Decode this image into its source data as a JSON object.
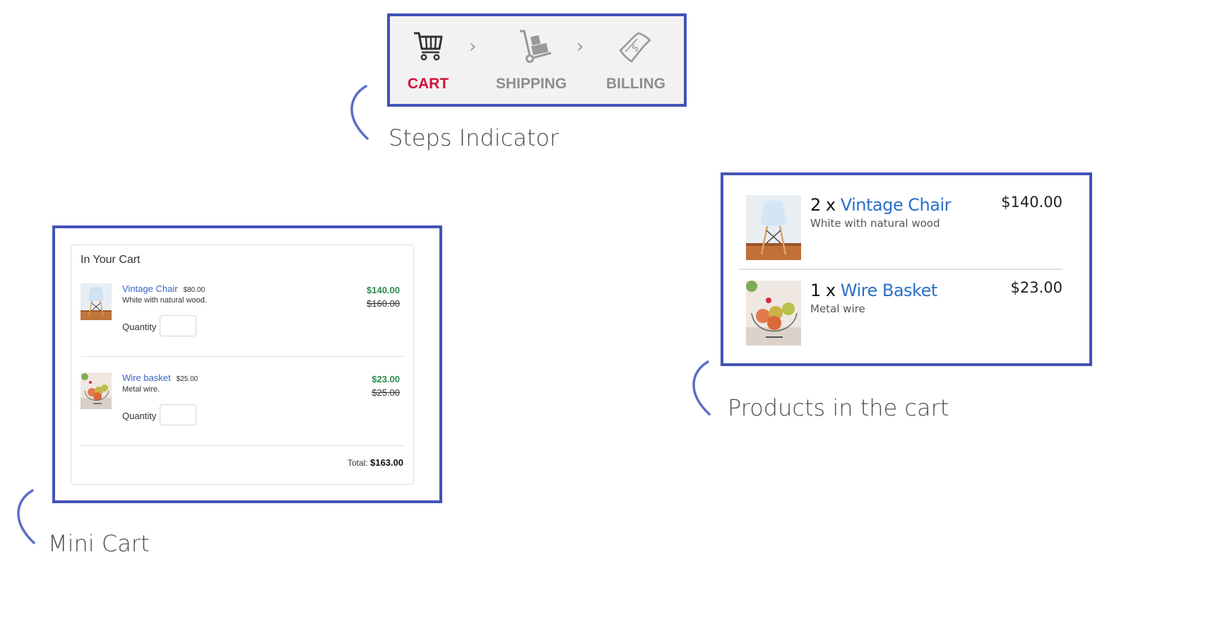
{
  "callouts": {
    "steps": "Steps Indicator",
    "mini_cart": "Mini Cart",
    "products": "Products in the cart"
  },
  "colors": {
    "frame": "#4353b8",
    "bracket": "#5b6ec7",
    "active_step": "#d0103a",
    "inactive_step": "#8e8e8e",
    "link": "#3a63c7",
    "sale_price": "#2a8a4e"
  },
  "steps_indicator": {
    "steps": [
      {
        "label": "CART",
        "icon": "shopping-cart-icon",
        "active": true
      },
      {
        "label": "SHIPPING",
        "icon": "hand-truck-icon",
        "active": false
      },
      {
        "label": "BILLING",
        "icon": "money-bill-icon",
        "active": false
      }
    ],
    "separator": "›"
  },
  "mini_cart": {
    "title": "In Your Cart",
    "items": [
      {
        "name": "Vintage Chair",
        "unit_price": "$80.00",
        "description": "White with natural wood.",
        "quantity_label": "Quantity",
        "quantity_value": "",
        "price": "$140.00",
        "old_price": "$160.00"
      },
      {
        "name": "Wire basket",
        "unit_price": "$25.00",
        "description": "Metal wire.",
        "quantity_label": "Quantity",
        "quantity_value": "",
        "price": "$23.00",
        "old_price": "$25.00"
      }
    ],
    "total_label": "Total:",
    "total_value": "$163.00"
  },
  "products": {
    "items": [
      {
        "qty": "2 x",
        "name": "Vintage Chair",
        "description": "White with natural wood",
        "price": "$140.00"
      },
      {
        "qty": "1 x",
        "name": "Wire Basket",
        "description": "Metal wire",
        "price": "$23.00"
      }
    ]
  }
}
